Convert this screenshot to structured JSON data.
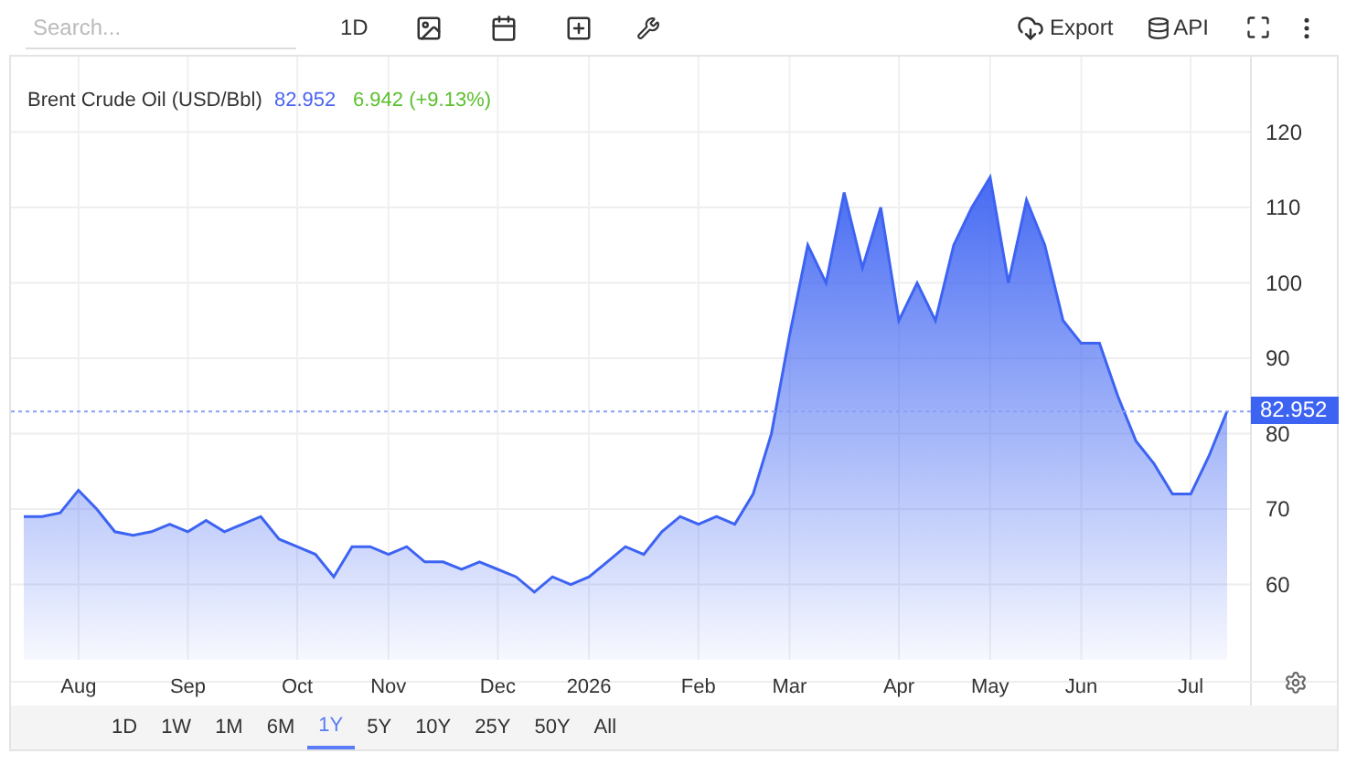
{
  "toolbar": {
    "search": {
      "placeholder": "Search..."
    },
    "interval": "1D",
    "export": "Export",
    "api": "API"
  },
  "legend": {
    "price": "82.952",
    "change": "6.942 (+9.13%)"
  },
  "chart_data": {
    "type": "area",
    "title": "Brent Crude Oil (USD/Bbl)",
    "categories": [
      null,
      null,
      null,
      "Aug",
      null,
      null,
      null,
      null,
      null,
      "Sep",
      null,
      null,
      null,
      null,
      null,
      "Oct",
      null,
      null,
      null,
      null,
      "Nov",
      null,
      null,
      null,
      null,
      null,
      "Dec",
      null,
      null,
      null,
      null,
      "2026",
      null,
      null,
      null,
      null,
      null,
      "Feb",
      null,
      null,
      null,
      null,
      "Mar",
      null,
      null,
      null,
      null,
      null,
      "Apr",
      null,
      null,
      null,
      null,
      "May",
      null,
      null,
      null,
      null,
      "Jun",
      null,
      null,
      null,
      null,
      null,
      "Jul",
      null,
      null
    ],
    "series": [
      {
        "color": "#3d63f2",
        "values": [
          69,
          69,
          69.5,
          72.5,
          70,
          67,
          66.5,
          67,
          68,
          67,
          68.5,
          67,
          68,
          69,
          66,
          65,
          64,
          61,
          65,
          65,
          64,
          65,
          63,
          63,
          62,
          63,
          62,
          61,
          59,
          61,
          60,
          61,
          63,
          65,
          64,
          67,
          69,
          68,
          69,
          68,
          72,
          80,
          93,
          105,
          100,
          112,
          102,
          110,
          95,
          100,
          95,
          105,
          110,
          114,
          100,
          111,
          105,
          95,
          92,
          92,
          85,
          79,
          76,
          72,
          72,
          77,
          83
        ]
      }
    ],
    "ylim": [
      50,
      130
    ],
    "yticks": [
      60,
      70,
      80,
      90,
      100,
      110,
      120
    ],
    "grid": true,
    "ref_lines": [
      {
        "axis": "y",
        "value": 82.952,
        "color": "#8aa0f5",
        "label": "82.952"
      }
    ]
  },
  "ranges": [
    {
      "label": "1D",
      "selected": false
    },
    {
      "label": "1W",
      "selected": false
    },
    {
      "label": "1M",
      "selected": false
    },
    {
      "label": "6M",
      "selected": false
    },
    {
      "label": "1Y",
      "selected": true
    },
    {
      "label": "5Y",
      "selected": false
    },
    {
      "label": "10Y",
      "selected": false
    },
    {
      "label": "25Y",
      "selected": false
    },
    {
      "label": "50Y",
      "selected": false
    },
    {
      "label": "All",
      "selected": false
    }
  ]
}
